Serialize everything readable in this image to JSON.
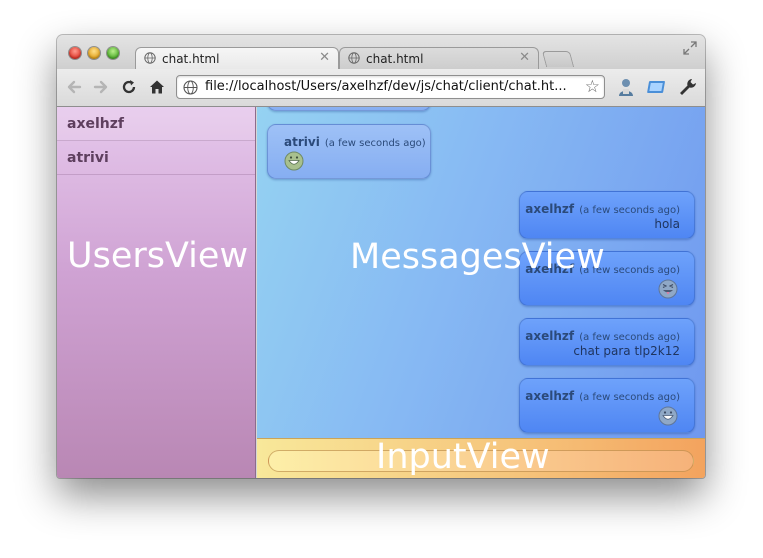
{
  "browser": {
    "tabs": [
      {
        "title": "chat.html",
        "active": true
      },
      {
        "title": "chat.html",
        "active": false
      }
    ],
    "tab_close_glyph": "✕",
    "url": "file://localhost/Users/axelhzf/dev/js/chat/client/chat.ht...",
    "star_glyph": "☆"
  },
  "users_view": {
    "users": [
      "axelhzf",
      "atrivi"
    ],
    "region_label": "UsersView"
  },
  "messages_view": {
    "region_label": "MessagesView",
    "messages": [
      {
        "user": "atrivi",
        "time": "(a few seconds ago)",
        "text": "",
        "emoji": "grinning-face",
        "side": "left"
      },
      {
        "user": "axelhzf",
        "time": "(a few seconds ago)",
        "text": "hola",
        "emoji": "",
        "side": "right"
      },
      {
        "user": "axelhzf",
        "time": "(a few seconds ago)",
        "text": "",
        "emoji": "squinting-tongue-face",
        "side": "right"
      },
      {
        "user": "axelhzf",
        "time": "(a few seconds ago)",
        "text": "chat para tlp2k12",
        "emoji": "",
        "side": "right"
      },
      {
        "user": "axelhzf",
        "time": "(a few seconds ago)",
        "text": "",
        "emoji": "grinning-face",
        "side": "right"
      }
    ]
  },
  "input_view": {
    "region_label": "InputView",
    "value": ""
  },
  "colors": {
    "users_bg": "#cfa2d3",
    "messages_bg": "#86b8f3",
    "bubble_right": "#4f86f3",
    "input_bg": "#f6c37a"
  }
}
